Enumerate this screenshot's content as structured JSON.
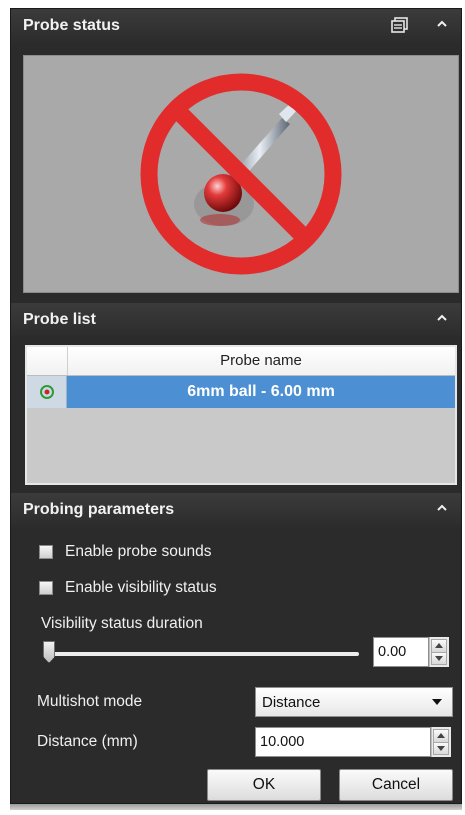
{
  "probe_status": {
    "title": "Probe status",
    "icon": "windows-stack-icon"
  },
  "probe_list": {
    "title": "Probe list",
    "column_header": "Probe name",
    "rows": [
      {
        "name": "6mm ball - 6.00 mm"
      }
    ]
  },
  "probing_parameters": {
    "title": "Probing parameters",
    "enable_probe_sounds": {
      "label": "Enable probe sounds",
      "checked": false
    },
    "enable_visibility_status": {
      "label": "Enable visibility status",
      "checked": false
    },
    "visibility_status_duration": {
      "label": "Visibility status duration",
      "value": "0.00"
    },
    "multishot_mode": {
      "label": "Multishot mode",
      "value": "Distance"
    },
    "distance": {
      "label": "Distance (mm)",
      "value": "10.000"
    },
    "ok_label": "OK",
    "cancel_label": "Cancel"
  },
  "colors": {
    "panel_background": "#2b2b2b",
    "selection_blue": "#4d8fd3",
    "prohibition_red": "#e22b2b"
  }
}
